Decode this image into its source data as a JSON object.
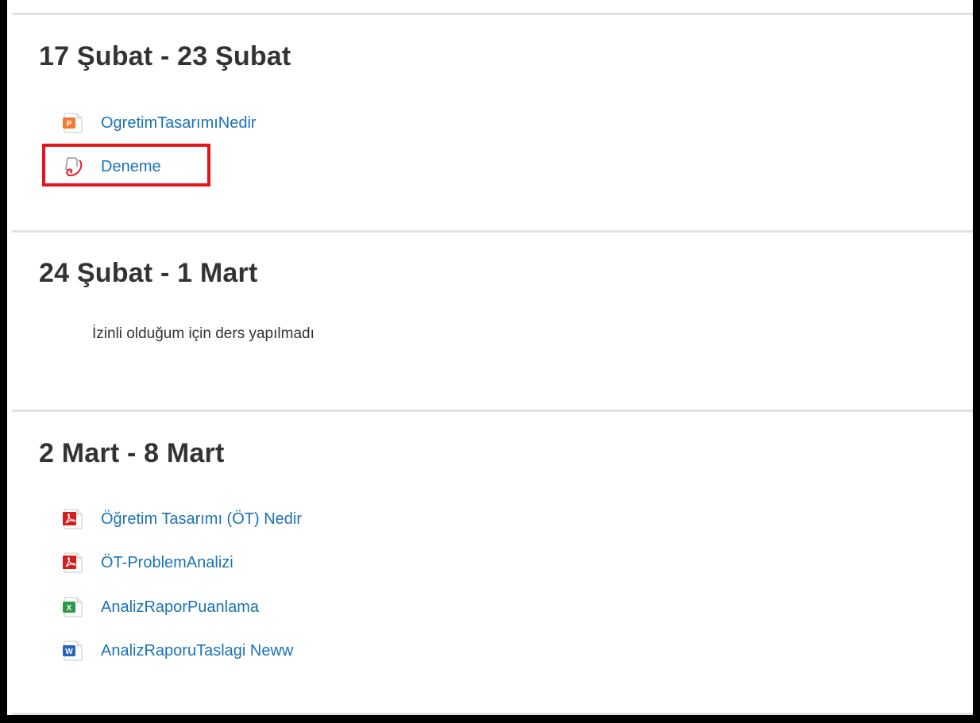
{
  "sections": [
    {
      "title": "17 Şubat - 23 Şubat",
      "activities": [
        {
          "label": "OgretimTasarımıNedir",
          "icon": "powerpoint-file-icon"
        },
        {
          "label": "Deneme",
          "icon": "assignment-icon"
        }
      ]
    },
    {
      "title": "24 Şubat - 1 Mart",
      "summary": "İzinli olduğum için ders yapılmadı"
    },
    {
      "title": "2 Mart - 8 Mart",
      "activities": [
        {
          "label": "Öğretim Tasarımı (ÖT) Nedir",
          "icon": "pdf-file-icon"
        },
        {
          "label": "ÖT-ProblemAnalizi",
          "icon": "pdf-file-icon"
        },
        {
          "label": "AnalizRaporPuanlama",
          "icon": "excel-file-icon"
        },
        {
          "label": "AnalizRaporuTaslagi Neww",
          "icon": "word-file-icon"
        }
      ]
    }
  ],
  "colors": {
    "link": "#1a73b5",
    "heading": "#333333",
    "highlight": "#e8141b",
    "divider": "#e3e3e3"
  }
}
